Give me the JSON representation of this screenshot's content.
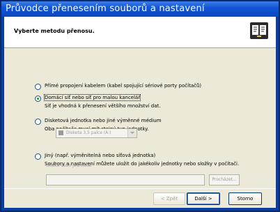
{
  "window": {
    "title": "Průvodce přenesením souborů a nastavení"
  },
  "header": {
    "title": "Vyberte metodu přenosu."
  },
  "options": [
    {
      "label": "Přímé propojení kabelem (kabel spojující sériové porty počítačů)",
      "checked": false
    },
    {
      "label": "Domácí síť nebo síť pro malou kancelář",
      "desc": "Síť je vhodná k přenesení většího množství dat.",
      "checked": true
    },
    {
      "label": "Disketová jednotka nebo jiné výměnné médium",
      "desc": "Oba počítače musí mít stejný typ jednotky.",
      "checked": false
    },
    {
      "label": "Jiný (např. výměnitelná nebo síťová jednotka)",
      "desc": "Soubory a nastavení můžete uložit do jakékoliv jednotky nebo složky v počítači.",
      "checked": false
    }
  ],
  "drive_select": {
    "value": "Disketa 3,5 palce (A:)"
  },
  "folder": {
    "label": "Složka nebo jednotka:",
    "value": ""
  },
  "buttons": {
    "browse": "Procházet...",
    "back": "< Zpět",
    "next": "Další >",
    "cancel": "Storno"
  }
}
